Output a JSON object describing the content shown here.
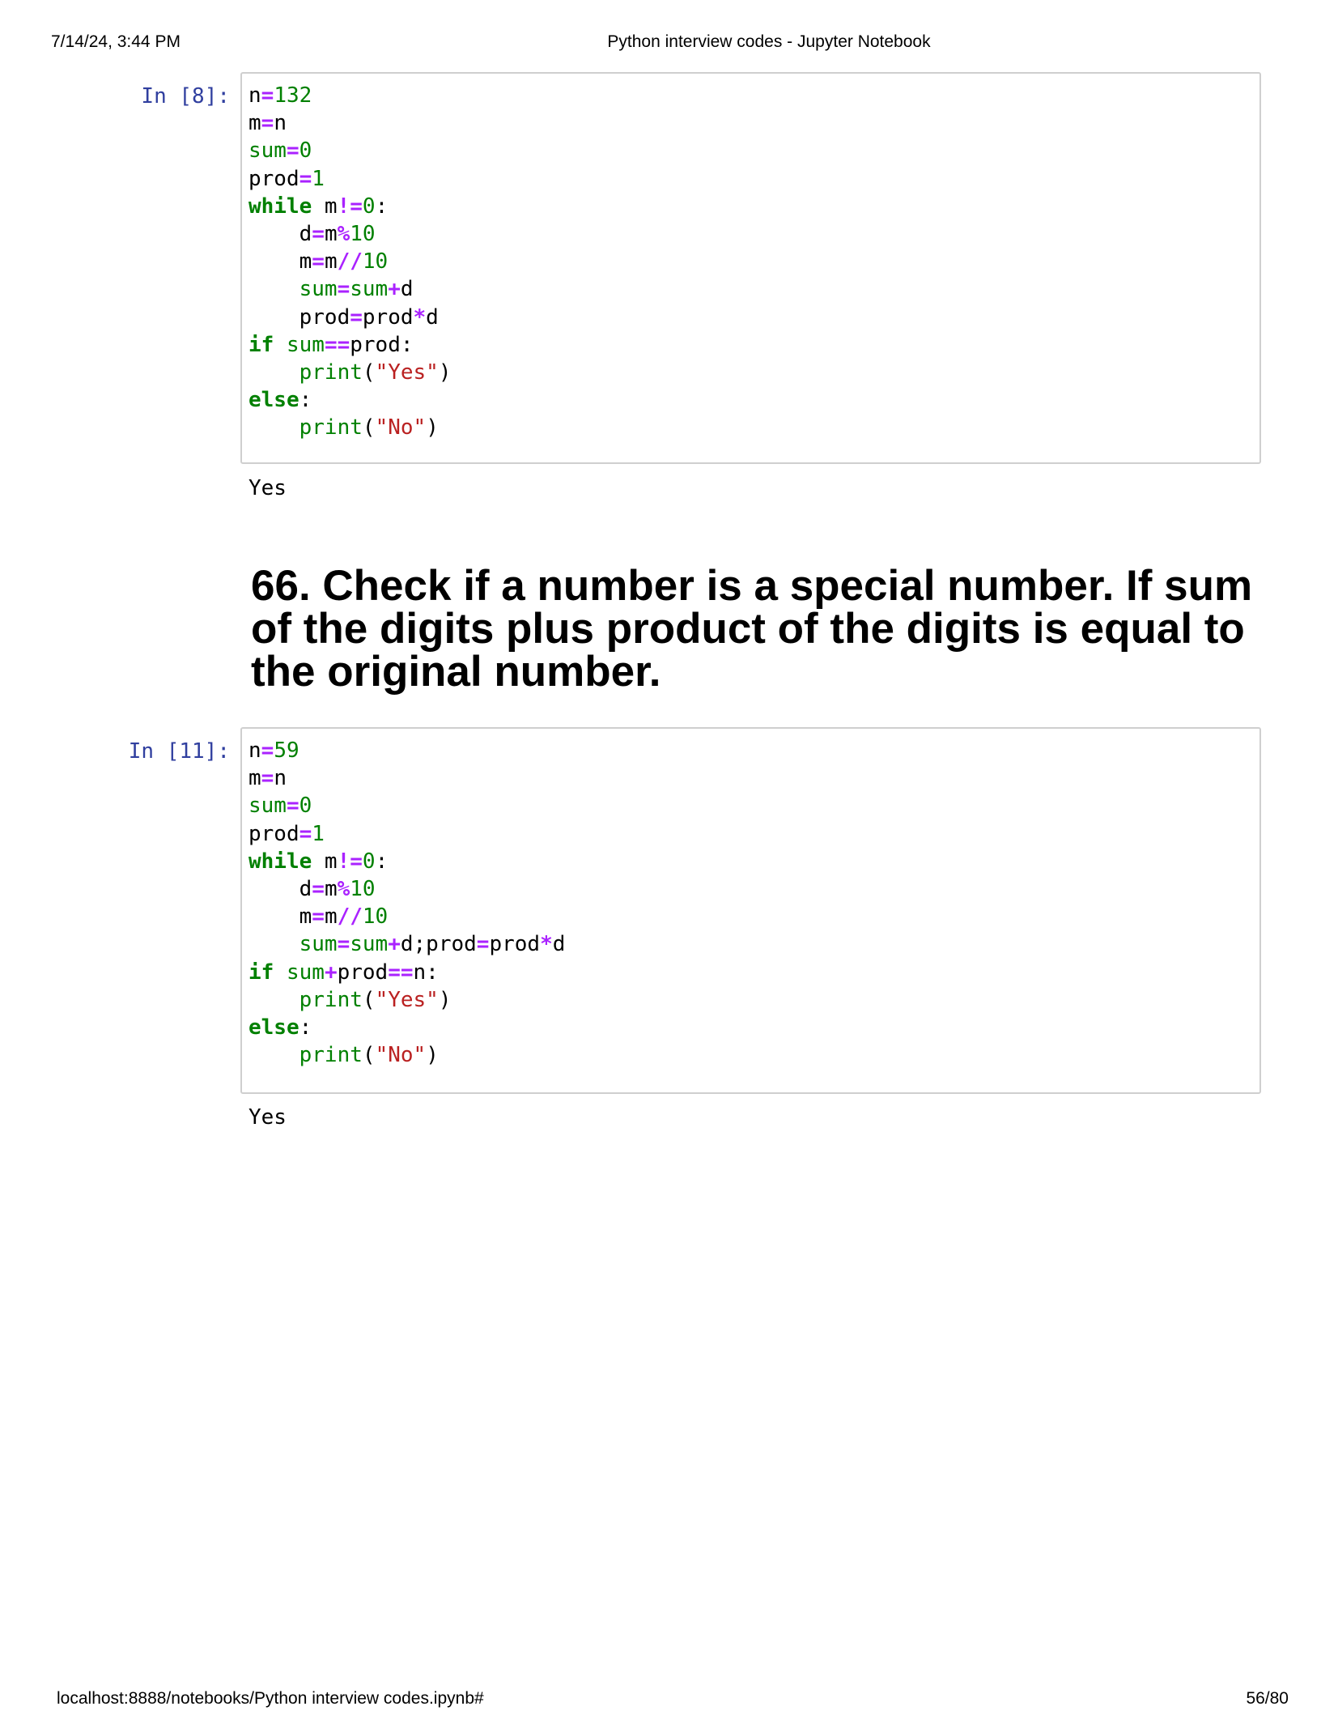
{
  "print_header": {
    "datetime": "7/14/24, 3:44 PM",
    "title": "Python interview codes - Jupyter Notebook"
  },
  "print_footer": {
    "url": "localhost:8888/notebooks/Python interview codes.ipynb#",
    "page": "56/80"
  },
  "cells": [
    {
      "prompt": "In [8]:",
      "code_lines": [
        "n=132",
        "m=n",
        "sum=0",
        "prod=1",
        "while m!=0:",
        "    d=m%10",
        "    m=m//10",
        "    sum=sum+d",
        "    prod=prod*d",
        "if sum==prod:",
        "    print(\"Yes\")",
        "else:",
        "    print(\"No\")"
      ],
      "output": "Yes"
    },
    {
      "prompt": "In [11]:",
      "code_lines": [
        "n=59",
        "m=n",
        "sum=0",
        "prod=1",
        "while m!=0:",
        "    d=m%10",
        "    m=m//10",
        "    sum=sum+d;prod=prod*d",
        "if sum+prod==n:",
        "    print(\"Yes\")",
        "else:",
        "    print(\"No\")"
      ],
      "output": "Yes"
    }
  ],
  "markdown": {
    "heading": "66. Check if a number is a special number. If sum of the digits plus product of the digits is equal to the original number."
  },
  "colors": {
    "prompt": "#303F9F",
    "keyword": "#008000",
    "operator": "#AA22FF",
    "string": "#BA2121",
    "cell_border": "#cfcfcf"
  }
}
